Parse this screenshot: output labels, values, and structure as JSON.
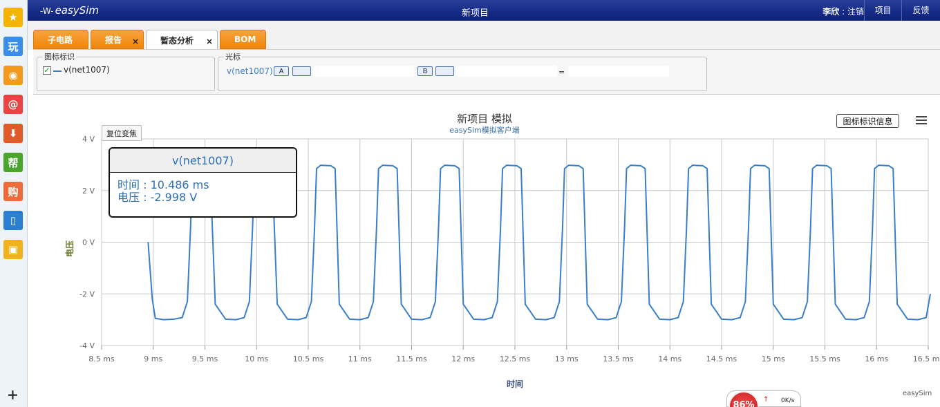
{
  "dock": {
    "items": [
      {
        "name": "favorite-star-icon",
        "glyph": "★",
        "color": "#f5b400"
      },
      {
        "name": "play-games-icon",
        "glyph": "玩",
        "color": "#3a8ee8"
      },
      {
        "name": "weibo-icon",
        "glyph": "◉",
        "color": "#f39a1c"
      },
      {
        "name": "mail-icon",
        "glyph": "@",
        "color": "#e94343"
      },
      {
        "name": "download-icon",
        "glyph": "⬇",
        "color": "#e15a2a"
      },
      {
        "name": "help-icon",
        "glyph": "帮",
        "color": "#4aa52c"
      },
      {
        "name": "shopping-icon",
        "glyph": "购",
        "color": "#ef6b3a"
      },
      {
        "name": "book-icon",
        "glyph": "▯",
        "color": "#2b7fd1"
      },
      {
        "name": "toolbox-icon",
        "glyph": "▣",
        "color": "#f2b21b"
      }
    ],
    "add_glyph": "+"
  },
  "topbar": {
    "logo_wave": "-W-",
    "logo_text": "easySim",
    "project_title": "新项目",
    "user_name": "李欣",
    "user_sep": " : ",
    "logout": "注销",
    "projects": "项目",
    "feedback": "反馈"
  },
  "tabs": [
    {
      "label": "子电路",
      "closable": false,
      "active": false
    },
    {
      "label": "报告",
      "closable": true,
      "active": false
    },
    {
      "label": "暂态分析",
      "closable": true,
      "active": true
    },
    {
      "label": "BOM",
      "closable": false,
      "active": false
    }
  ],
  "tab_close_glyph": "×",
  "legend_panel": {
    "title": "图标标识",
    "checked_glyph": "✓",
    "signal": "v(net1007)"
  },
  "cursor_panel": {
    "title": "光标",
    "signal": "v(net1007)",
    "a_label": "A",
    "b_label": "B",
    "eq": "="
  },
  "chart": {
    "reset_zoom": "复位变焦",
    "legend_info": "图标标识信息",
    "credit": "easySim",
    "tooltip": {
      "title": "v(net1007)",
      "time_line": "时间 : 10.486 ms",
      "voltage_line": "电压 : -2.998 V"
    }
  },
  "speed_widget": {
    "percent": "86%",
    "up_glyph": "↑",
    "rate": "0K/s"
  },
  "chart_data": {
    "type": "line",
    "title": "新项目 模拟",
    "subtitle": "easySim模拟客户端",
    "xlabel": "时间",
    "ylabel": "电压",
    "xlim": [
      8.5,
      16.5
    ],
    "ylim": [
      -4,
      4
    ],
    "x_ticks": [
      "8.5 ms",
      "9 ms",
      "9.5 ms",
      "10 ms",
      "10.5 ms",
      "11 ms",
      "11.5 ms",
      "12 ms",
      "12.5 ms",
      "13 ms",
      "13.5 ms",
      "14 ms",
      "14.5 ms",
      "15 ms",
      "15.5 ms",
      "16 ms",
      "16.5 ms"
    ],
    "x_tick_values": [
      8.5,
      9,
      9.5,
      10,
      10.5,
      11,
      11.5,
      12,
      12.5,
      13,
      13.5,
      14,
      14.5,
      15,
      15.5,
      16,
      16.5
    ],
    "y_ticks": [
      "4 V",
      "2 V",
      "0 V",
      "-2 V",
      "-4 V"
    ],
    "y_tick_values": [
      4,
      2,
      0,
      -2,
      -4
    ],
    "grid": true,
    "line_color": "#3a7ec9",
    "series": [
      {
        "name": "v(net1007)",
        "x": [
          8.95,
          8.99,
          9.02,
          9.1,
          9.2,
          9.28,
          9.33,
          9.36,
          9.38,
          9.42,
          9.51,
          9.55,
          9.6,
          9.7,
          9.8,
          9.88,
          9.93,
          9.96,
          9.98,
          10.02,
          10.11,
          10.15,
          10.2,
          10.3,
          10.4,
          10.48,
          10.53,
          10.56,
          10.58,
          10.62,
          10.72,
          10.76,
          10.8,
          10.9,
          11,
          11.08,
          11.13,
          11.16,
          11.18,
          11.22,
          11.32,
          11.36,
          11.4,
          11.5,
          11.6,
          11.68,
          11.73,
          11.76,
          11.78,
          11.82,
          11.92,
          11.96,
          12.0,
          12.1,
          12.2,
          12.28,
          12.33,
          12.36,
          12.38,
          12.42,
          12.52,
          12.56,
          12.6,
          12.7,
          12.8,
          12.88,
          12.93,
          12.96,
          12.98,
          13.02,
          13.12,
          13.16,
          13.2,
          13.3,
          13.4,
          13.48,
          13.53,
          13.56,
          13.58,
          13.62,
          13.72,
          13.76,
          13.8,
          13.9,
          14.0,
          14.08,
          14.13,
          14.16,
          14.18,
          14.22,
          14.32,
          14.36,
          14.4,
          14.5,
          14.6,
          14.68,
          14.73,
          14.76,
          14.78,
          14.82,
          14.92,
          14.96,
          15.0,
          15.1,
          15.2,
          15.28,
          15.33,
          15.36,
          15.38,
          15.42,
          15.52,
          15.56,
          15.6,
          15.7,
          15.8,
          15.88,
          15.93,
          15.96,
          15.98,
          16.02,
          16.12,
          16.16,
          16.2,
          16.3,
          16.4,
          16.48,
          16.52
        ],
        "y": [
          0.0,
          -2.2,
          -2.95,
          -3.0,
          -2.98,
          -2.92,
          -2.3,
          0.5,
          2.85,
          2.98,
          2.96,
          2.85,
          -2.4,
          -2.98,
          -3.0,
          -2.92,
          -2.3,
          0.5,
          2.85,
          2.98,
          2.96,
          2.85,
          -2.4,
          -2.98,
          -3.0,
          -2.92,
          -2.3,
          0.5,
          2.85,
          2.98,
          2.96,
          2.85,
          -2.4,
          -2.98,
          -3.0,
          -2.92,
          -2.3,
          0.5,
          2.85,
          2.98,
          2.96,
          2.85,
          -2.4,
          -2.98,
          -3.0,
          -2.92,
          -2.3,
          0.5,
          2.85,
          2.98,
          2.96,
          2.85,
          -2.4,
          -2.98,
          -3.0,
          -2.92,
          -2.3,
          0.5,
          2.85,
          2.98,
          2.96,
          2.85,
          -2.4,
          -2.98,
          -3.0,
          -2.92,
          -2.3,
          0.5,
          2.85,
          2.98,
          2.96,
          2.85,
          -2.4,
          -2.98,
          -3.0,
          -2.92,
          -2.3,
          0.5,
          2.85,
          2.98,
          2.96,
          2.85,
          -2.4,
          -2.98,
          -3.0,
          -2.92,
          -2.3,
          0.5,
          2.85,
          2.98,
          2.96,
          2.85,
          -2.4,
          -2.98,
          -3.0,
          -2.92,
          -2.3,
          0.5,
          2.85,
          2.98,
          2.96,
          2.85,
          -2.4,
          -2.98,
          -3.0,
          -2.92,
          -2.3,
          0.5,
          2.85,
          2.98,
          2.96,
          2.85,
          -2.4,
          -2.98,
          -3.0,
          -2.92,
          -2.3,
          0.5,
          2.85,
          2.98,
          2.96,
          2.85,
          -2.4,
          -2.98,
          -3.0,
          -2.92,
          -2.0
        ]
      }
    ]
  }
}
